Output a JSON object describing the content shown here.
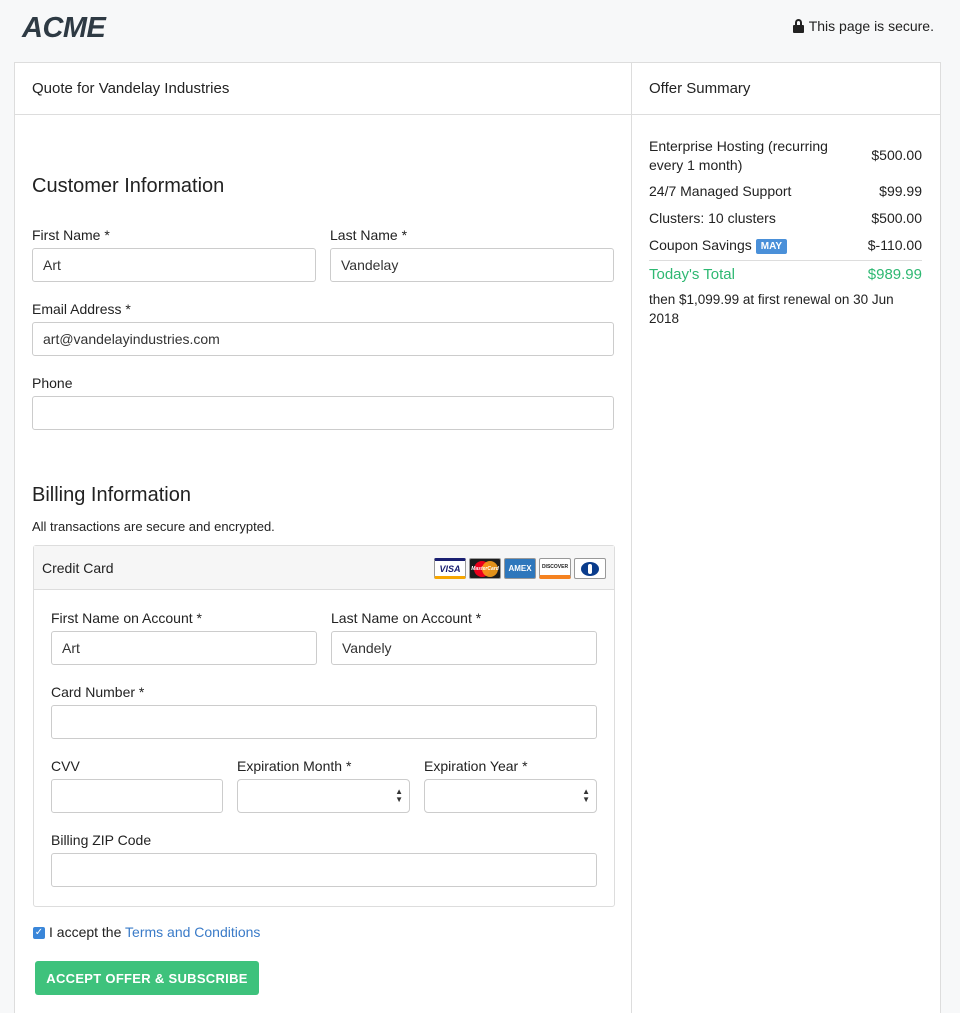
{
  "header": {
    "logo": "ACME",
    "secure_text": "This page is secure."
  },
  "main": {
    "title": "Quote for Vandelay Industries",
    "customer": {
      "heading": "Customer Information",
      "first_name_label": "First Name *",
      "first_name_value": "Art",
      "last_name_label": "Last Name *",
      "last_name_value": "Vandelay",
      "email_label": "Email Address *",
      "email_value": "art@vandelayindustries.com",
      "phone_label": "Phone",
      "phone_value": ""
    },
    "billing": {
      "heading": "Billing Information",
      "note": "All transactions are secure and encrypted.",
      "method_label": "Credit Card",
      "cards": [
        "VISA",
        "MasterCard",
        "AMEX",
        "DISCOVER",
        "Diners Club"
      ],
      "first_name_label": "First Name on Account *",
      "first_name_value": "Art",
      "last_name_label": "Last Name on Account *",
      "last_name_value": "Vandely",
      "card_number_label": "Card Number *",
      "card_number_value": "",
      "cvv_label": "CVV",
      "cvv_value": "",
      "exp_month_label": "Expiration Month *",
      "exp_month_value": "",
      "exp_year_label": "Expiration Year *",
      "exp_year_value": "",
      "zip_label": "Billing ZIP Code",
      "zip_value": ""
    },
    "terms": {
      "checked": true,
      "prefix": "I accept the",
      "link": "Terms and Conditions"
    },
    "submit_label": "ACCEPT OFFER & SUBSCRIBE"
  },
  "summary": {
    "title": "Offer Summary",
    "items": [
      {
        "label": "Enterprise Hosting (recurring every 1 month)",
        "amount": "$500.00"
      },
      {
        "label": "24/7 Managed Support",
        "amount": "$99.99"
      },
      {
        "label": "Clusters: 10 clusters",
        "amount": "$500.00"
      },
      {
        "label": "Coupon Savings",
        "badge": "MAY",
        "amount": "$-110.00"
      }
    ],
    "total_label": "Today's Total",
    "total_amount": "$989.99",
    "renewal_note": "then $1,099.99 at first renewal on 30 Jun 2018"
  },
  "colors": {
    "accent_green": "#3ec27c",
    "link_blue": "#3a7bc8",
    "badge_blue": "#4a90d9"
  }
}
